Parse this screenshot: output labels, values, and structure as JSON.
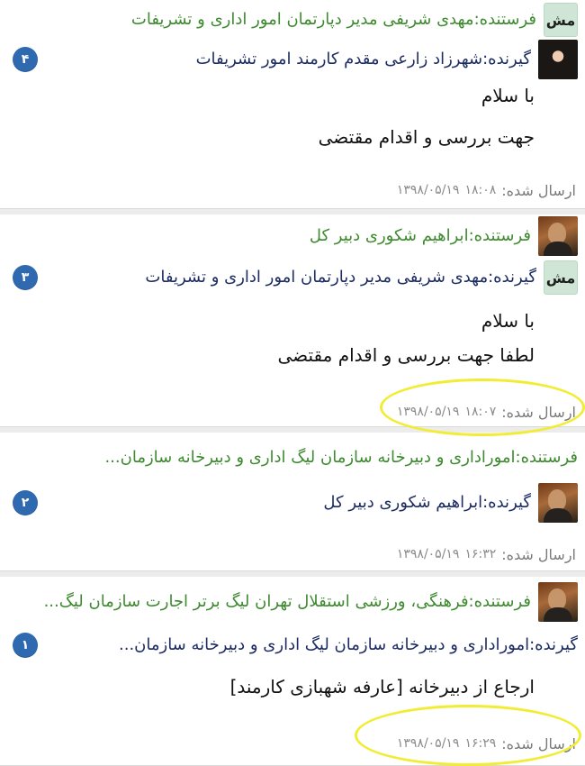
{
  "messages": [
    {
      "sender_label": "فرستنده:مهدی شریفی مدیر دپارتمان امور اداری و تشریفات",
      "sender_avatar_initials": "مش",
      "receiver_label": "گیرنده:شهرزاد زارعی مقدم کارمند امور تشریفات",
      "badge_count": "۴",
      "body_lines": [
        "با سلام",
        "جهت بررسی و اقدام مقتضی"
      ],
      "sent_label": "ارسال شده:",
      "sent_time": "۱۸:۰۸",
      "sent_date": "۱۳۹۸/۰۵/۱۹"
    },
    {
      "sender_label": "فرستنده:ابراهیم شکوری دبیر کل",
      "receiver_label": "گیرنده:مهدی شریفی مدیر دپارتمان امور اداری و تشریفات",
      "receiver_avatar_initials": "مش",
      "badge_count": "۳",
      "body_lines": [
        "با سلام",
        "لطفا جهت بررسی و اقدام مقتضی"
      ],
      "sent_label": "ارسال شده:",
      "sent_time": "۱۸:۰۷",
      "sent_date": "۱۳۹۸/۰۵/۱۹"
    },
    {
      "sender_label": "فرستنده:اموراداری و دبیرخانه سازمان لیگ اداری و دبیرخانه سازمان...",
      "receiver_label": "گیرنده:ابراهیم شکوری دبیر کل",
      "badge_count": "۲",
      "sent_label": "ارسال شده:",
      "sent_time": "۱۶:۳۲",
      "sent_date": "۱۳۹۸/۰۵/۱۹"
    },
    {
      "sender_label": "فرستنده:فرهنگی، ورزشی استقلال تهران لیگ برتر اجارت سازمان لیگ...",
      "receiver_label": "گیرنده:اموراداری و دبیرخانه سازمان لیگ اداری و دبیرخانه سازمان...",
      "badge_count": "۱",
      "body_lines": [
        "ارجاع از دبیرخانه [عارفه شهبازی کارمند]"
      ],
      "sent_label": "ارسال شده:",
      "sent_time": "۱۶:۲۹",
      "sent_date": "۱۳۹۸/۰۵/۱۹"
    }
  ],
  "ui": {
    "highlight_color": "#f2ec34",
    "sender_color": "#3d8a2f",
    "receiver_color": "#1c2c63",
    "badge_color": "#2f69b0",
    "icons": {
      "female_avatar": "avatar-woman-icon",
      "male_avatar": "avatar-man-icon",
      "initials_avatar": "initials-avatar-icon",
      "counter_badge": "counter-badge-icon"
    }
  }
}
